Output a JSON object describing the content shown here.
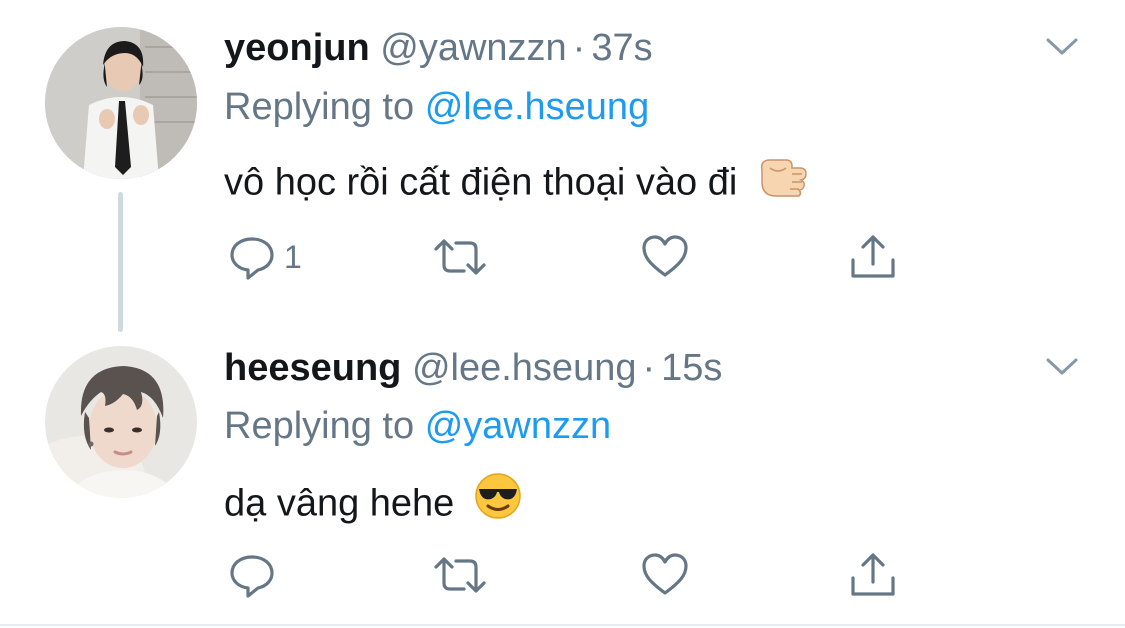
{
  "tweets": [
    {
      "author": {
        "name": "yeonjun",
        "handle": "@yawnzzn"
      },
      "separator": "·",
      "time": "37s",
      "reply_prefix": "Replying to",
      "reply_to": "@lee.hseung",
      "text": "vô học rồi cất điện thoại vào đi",
      "emoji": "backhand-index-pointing-left",
      "reply_count": "1",
      "actions": [
        "reply-icon",
        "retweet-icon",
        "like-icon",
        "share-icon"
      ]
    },
    {
      "author": {
        "name": "heeseung",
        "handle": "@lee.hseung"
      },
      "separator": "·",
      "time": "15s",
      "reply_prefix": "Replying to",
      "reply_to": "@yawnzzn",
      "text": "dạ vâng hehe",
      "emoji": "smiling-face-with-sunglasses",
      "reply_count": "",
      "actions": [
        "reply-icon",
        "retweet-icon",
        "like-icon",
        "share-icon"
      ]
    }
  ],
  "colors": {
    "primary_text": "#14171a",
    "secondary_text": "#657786",
    "mention": "#1d9bf0",
    "thread_line": "#cfd9de"
  }
}
